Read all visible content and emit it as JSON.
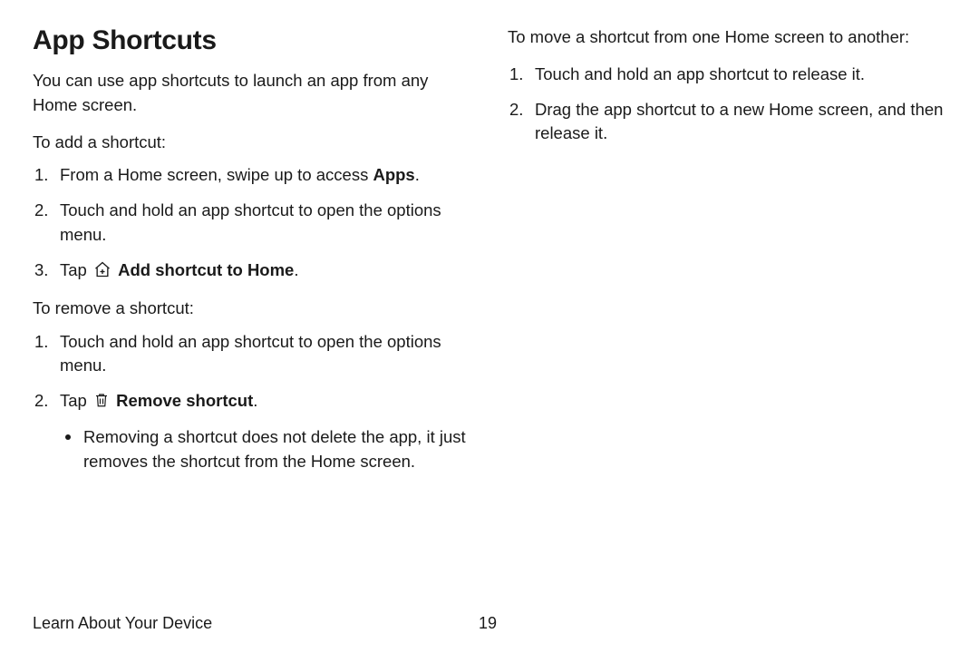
{
  "title": "App Shortcuts",
  "intro": "You can use app shortcuts to launch an app from any Home screen.",
  "add": {
    "lead": "To add a shortcut:",
    "steps": {
      "s1_pre": "From a Home screen, swipe up to access ",
      "s1_bold": "Apps",
      "s1_post": ".",
      "s2": "Touch and hold an app shortcut to open the options menu.",
      "s3_pre": "Tap ",
      "s3_bold": "Add shortcut to Home",
      "s3_post": "."
    }
  },
  "remove": {
    "lead": "To remove a shortcut:",
    "steps": {
      "s1": "Touch and hold an app shortcut to open the options menu.",
      "s2_pre": "Tap ",
      "s2_bold": "Remove shortcut",
      "s2_post": ".",
      "note": "Removing a shortcut does not delete the app, it just removes the shortcut from the Home screen."
    }
  },
  "move": {
    "lead": "To move a shortcut from one Home screen to another:",
    "steps": {
      "s1": "Touch and hold an app shortcut to release it.",
      "s2": "Drag the app shortcut to a new Home screen, and then release it."
    }
  },
  "footer": {
    "section": "Learn About Your Device",
    "page": "19"
  }
}
